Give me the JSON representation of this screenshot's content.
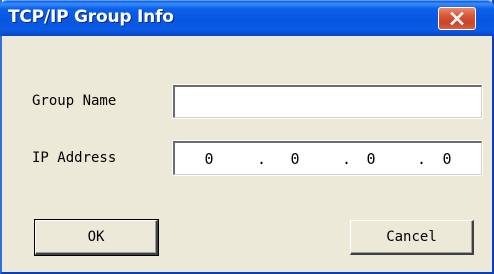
{
  "window": {
    "title": "TCP/IP Group Info"
  },
  "icons": {
    "close": "close-icon"
  },
  "colors": {
    "titlebar": "#0756e0",
    "close_button": "#d9583a",
    "window_body": "#ece9d8"
  },
  "form": {
    "group_name_label": "Group Name",
    "group_name_value": "",
    "ip_address_label": "IP Address",
    "ip_octets": [
      "0",
      "0",
      "0",
      "0"
    ],
    "ip_separator": "."
  },
  "buttons": {
    "ok_label": "OK",
    "cancel_label": "Cancel"
  }
}
